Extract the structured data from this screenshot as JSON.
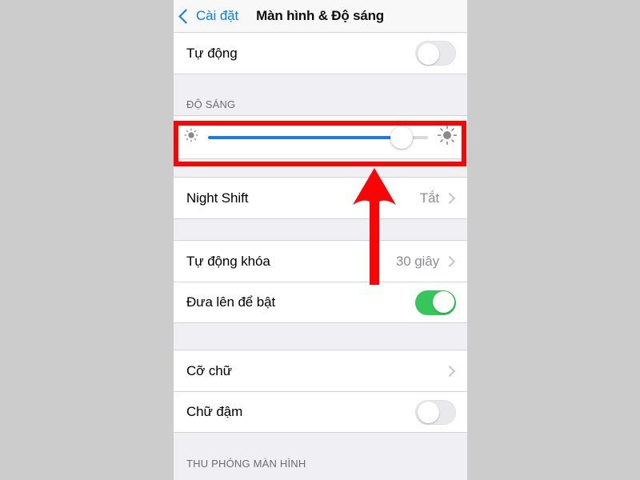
{
  "backdrop": {
    "color": "#cccccc"
  },
  "nav": {
    "back_label": "Cài đặt",
    "title": "Màn hình & Độ sáng",
    "back_icon": "chevron-left-icon",
    "accent_color": "#0a7cff"
  },
  "sections": {
    "auto": {
      "row_label": "Tự động",
      "toggle_state": "off"
    },
    "brightness": {
      "header": "ĐỘ SÁNG",
      "slider": {
        "value_percent": 88,
        "fill_color": "#1a7aea",
        "low_icon": "sun-low-icon",
        "high_icon": "sun-high-icon"
      }
    },
    "night_shift": {
      "row_label": "Night Shift",
      "row_value": "Tắt",
      "accessory_icon": "chevron-right-icon"
    },
    "lock": {
      "auto_lock_label": "Tự động khóa",
      "auto_lock_value": "30 giây",
      "auto_lock_accessory_icon": "chevron-right-icon",
      "raise_to_wake_label": "Đưa lên để bật",
      "raise_to_wake_toggle_state": "on",
      "on_color": "#35c759"
    },
    "text": {
      "text_size_label": "Cỡ chữ",
      "text_size_accessory_icon": "chevron-right-icon",
      "bold_text_label": "Chữ đậm",
      "bold_text_toggle_state": "off"
    },
    "display_zoom": {
      "header": "THU PHÓNG MÀN HÌNH"
    }
  },
  "annotations": {
    "highlight_box": {
      "color": "#fa0505",
      "target": "brightness-slider"
    },
    "arrow": {
      "color": "#fa0505",
      "direction": "up",
      "target": "brightness-slider"
    }
  }
}
